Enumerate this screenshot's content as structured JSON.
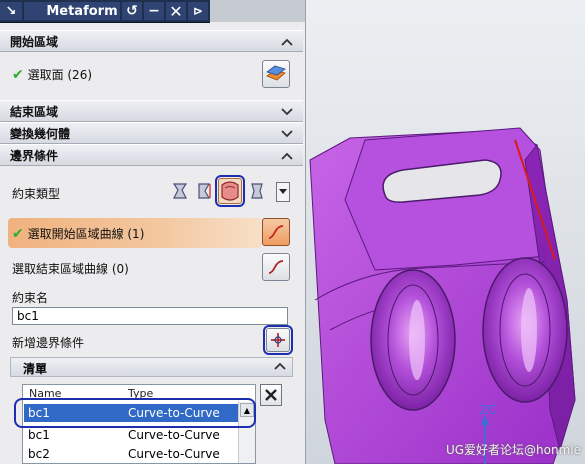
{
  "titlebar": {
    "title": "Metaform",
    "arrow_glyph": "↘",
    "reset_glyph": "↺",
    "min_glyph": "−",
    "close_glyph": "✕",
    "extra_glyph": "⊳"
  },
  "sections": {
    "start_region": {
      "label": "開始區域",
      "selection_label": "選取面 (26)",
      "expanded": true
    },
    "end_region": {
      "label": "結束區域",
      "expanded": false
    },
    "transform_geometry": {
      "label": "變換幾何體",
      "expanded": false
    },
    "boundary_conditions": {
      "label": "邊界條件",
      "expanded": true,
      "constraint_type_label": "約束類型",
      "select_start_curve_label": "選取開始區域曲線 (1)",
      "select_end_curve_label": "選取結束區域曲線 (0)",
      "constraint_name_label": "約束名",
      "constraint_name_value": "bc1",
      "add_condition_label": "新增邊界條件"
    },
    "list": {
      "label": "清單",
      "columns": [
        "Name",
        "Type"
      ],
      "rows": [
        {
          "name": "bc1",
          "type": "Curve-to-Curve",
          "selected": true
        },
        {
          "name": "bc1",
          "type": "Curve-to-Curve",
          "selected": false
        },
        {
          "name": "bc2",
          "type": "Curve-to-Curve",
          "selected": false
        }
      ]
    }
  },
  "viewport": {
    "axis_label": "ZC",
    "watermark": "UG爱好者论坛@honmle",
    "part_color": "#a63ad2",
    "edge_highlight_color": "#d81c1c"
  },
  "icons": {
    "collapse": "chevron-up-icon",
    "expand": "chevron-down-icon",
    "check": "check-icon",
    "select_face": "select-face-icon",
    "curve": "curve-icon",
    "add": "add-crosshair-icon",
    "remove": "close-icon"
  }
}
